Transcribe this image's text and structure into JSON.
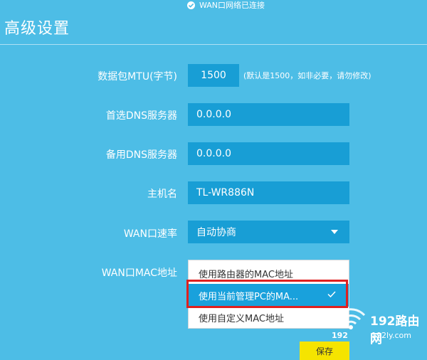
{
  "status": {
    "text": "WAN口网络已连接",
    "icon": "check-circle-icon"
  },
  "page_title": "高级设置",
  "form": {
    "mtu": {
      "label": "数据包MTU(字节)",
      "value": "1500",
      "hint": "(默认是1500，如非必要，请勿修改)"
    },
    "primary_dns": {
      "label": "首选DNS服务器",
      "value": "0.0.0.0"
    },
    "secondary_dns": {
      "label": "备用DNS服务器",
      "value": "0.0.0.0"
    },
    "hostname": {
      "label": "主机名",
      "value": "TL-WR886N"
    },
    "wan_speed": {
      "label": "WAN口速率",
      "value": "自动协商"
    },
    "wan_mac": {
      "label": "WAN口MAC地址",
      "options": [
        "使用路由器的MAC地址",
        "使用当前管理PC的MA...",
        "使用自定义MAC地址"
      ],
      "selected_index": 1
    }
  },
  "save_label": "保存",
  "watermark": {
    "brand": "192路由网",
    "url": "192ly.com",
    "prefix": "192"
  },
  "colors": {
    "background": "#4dbde6",
    "field": "#189ed5",
    "selected_option": "#19a1dc",
    "highlight_box": "#e0201f",
    "save_button": "#f5e400"
  }
}
